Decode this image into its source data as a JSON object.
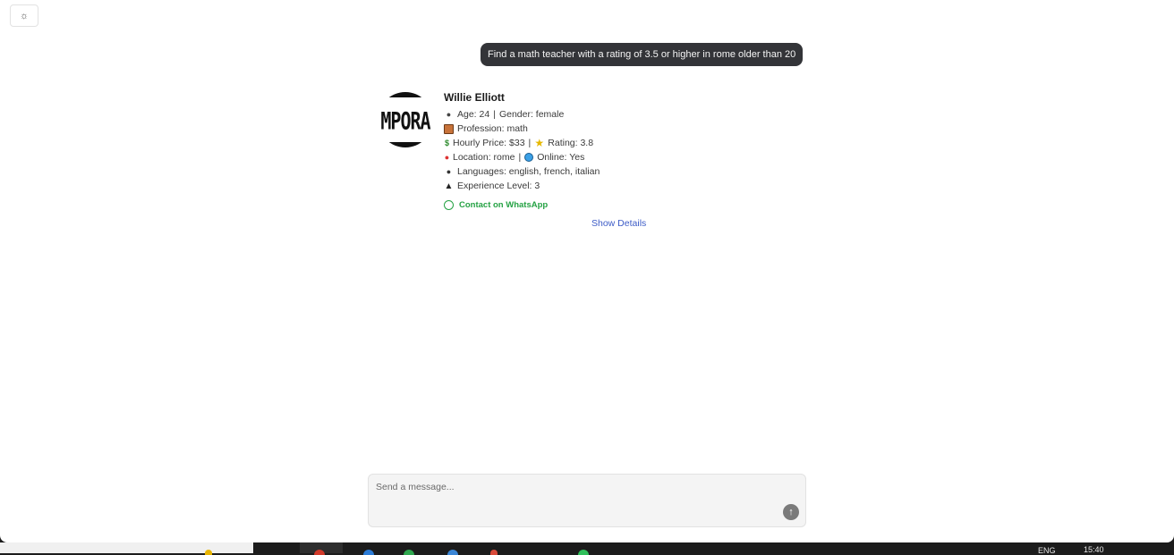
{
  "toolbar": {
    "theme_icon": "sun-icon",
    "theme_glyph": "☼"
  },
  "chat": {
    "user_message": "Find a math teacher with a rating of 3.5 or higher in rome older than 20"
  },
  "result": {
    "avatar_text": "MPORA",
    "name": "Willie Elliott",
    "age_label": "Age: 24",
    "gender_label": "Gender: female",
    "profession_label": "Profession: math",
    "price_label": "Hourly Price: $33",
    "rating_label": "Rating: 3.8",
    "location_label": "Location: rome",
    "online_label": "Online: Yes",
    "languages_label": "Languages: english, french, italian",
    "experience_label": "Experience Level: 3",
    "separator": "|",
    "whatsapp_label": "Contact on WhatsApp",
    "show_details_label": "Show Details"
  },
  "composer": {
    "placeholder": "Send a message...",
    "value": "",
    "send_glyph": "↑"
  },
  "taskbar": {
    "language": "ENG",
    "time": "15:40"
  },
  "colors": {
    "bubble_bg": "#333438",
    "whatsapp_green": "#25a244",
    "link_blue": "#3d5cc7"
  }
}
